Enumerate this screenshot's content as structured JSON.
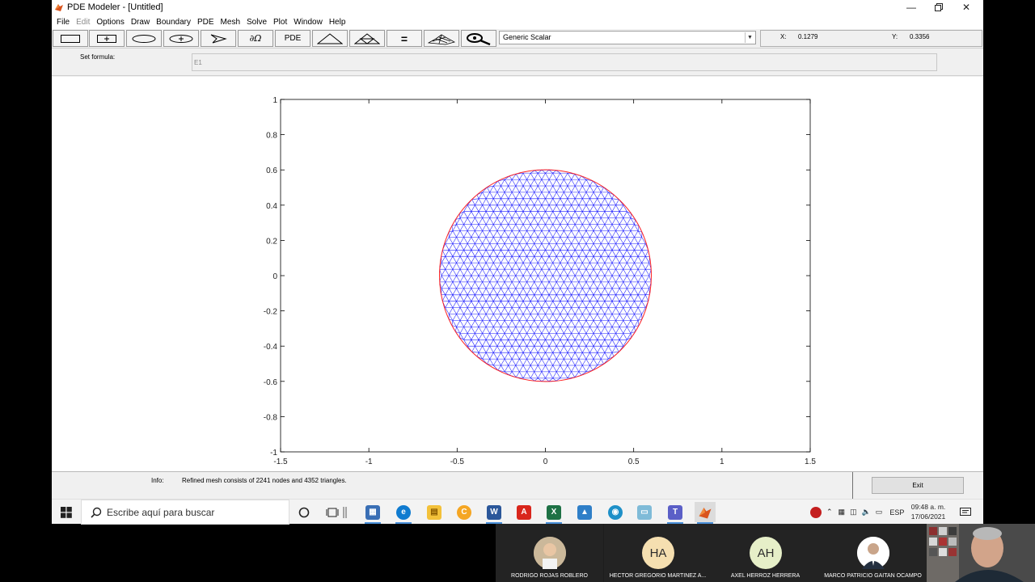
{
  "window": {
    "title": "PDE Modeler - [Untitled]",
    "minimize_icon": "minimize-icon",
    "restore_icon": "restore-icon",
    "close_icon": "close-icon"
  },
  "menu": [
    "File",
    "Edit",
    "Options",
    "Draw",
    "Boundary",
    "PDE",
    "Mesh",
    "Solve",
    "Plot",
    "Window",
    "Help"
  ],
  "menu_disabled": [
    "Edit"
  ],
  "toolbar": {
    "buttons": [
      {
        "name": "rectangle-corner-icon"
      },
      {
        "name": "rectangle-center-icon"
      },
      {
        "name": "ellipse-corner-icon"
      },
      {
        "name": "ellipse-center-icon"
      },
      {
        "name": "polygon-icon"
      },
      {
        "name": "boundary-mode-icon",
        "label": "∂Ω"
      },
      {
        "name": "pde-spec-button",
        "label": "PDE"
      },
      {
        "name": "init-mesh-icon"
      },
      {
        "name": "refine-mesh-icon"
      },
      {
        "name": "solve-icon",
        "label": "="
      },
      {
        "name": "plot-3d-icon"
      },
      {
        "name": "zoom-icon"
      }
    ],
    "application_mode": "Generic Scalar",
    "x_label": "X:",
    "x_value": "0.1279",
    "y_label": "Y:",
    "y_value": "0.3356"
  },
  "formula": {
    "label": "Set formula:",
    "value": "E1"
  },
  "plot": {
    "x_ticks": [
      "-1.5",
      "-1",
      "-0.5",
      "0",
      "0.5",
      "1",
      "1.5"
    ],
    "y_ticks": [
      "1",
      "0.8",
      "0.6",
      "0.4",
      "0.2",
      "0",
      "-0.2",
      "-0.4",
      "-0.6",
      "-0.8",
      "-1"
    ],
    "mesh_color": "#1a1aff",
    "boundary_color": "#ff2020",
    "circle_center": [
      0,
      0
    ],
    "circle_radius": 0.6
  },
  "info": {
    "label": "Info:",
    "text": "Refined mesh consists of 2241 nodes and 4352 triangles."
  },
  "exit_label": "Exit",
  "taskbar": {
    "search_placeholder": "Escribe aquí para buscar",
    "language": "ESP",
    "time": "09:48 a. m.",
    "date": "17/06/2021"
  },
  "participants": [
    {
      "initials": "",
      "name": "RODRIGO  ROJAS ROBLERO",
      "avatar_color": "#d8c6a8"
    },
    {
      "initials": "HA",
      "name": "HÉCTOR GREGORIO  MARTÍNEZ A...",
      "avatar_color": "#f5dfb0"
    },
    {
      "initials": "AH",
      "name": "AXEL  HERROZ HERRERA",
      "avatar_color": "#e6efc8"
    },
    {
      "initials": "",
      "name": "MARCO PATRICIO  GAITAN OCAMPO",
      "avatar_color": "#ffffff"
    }
  ]
}
